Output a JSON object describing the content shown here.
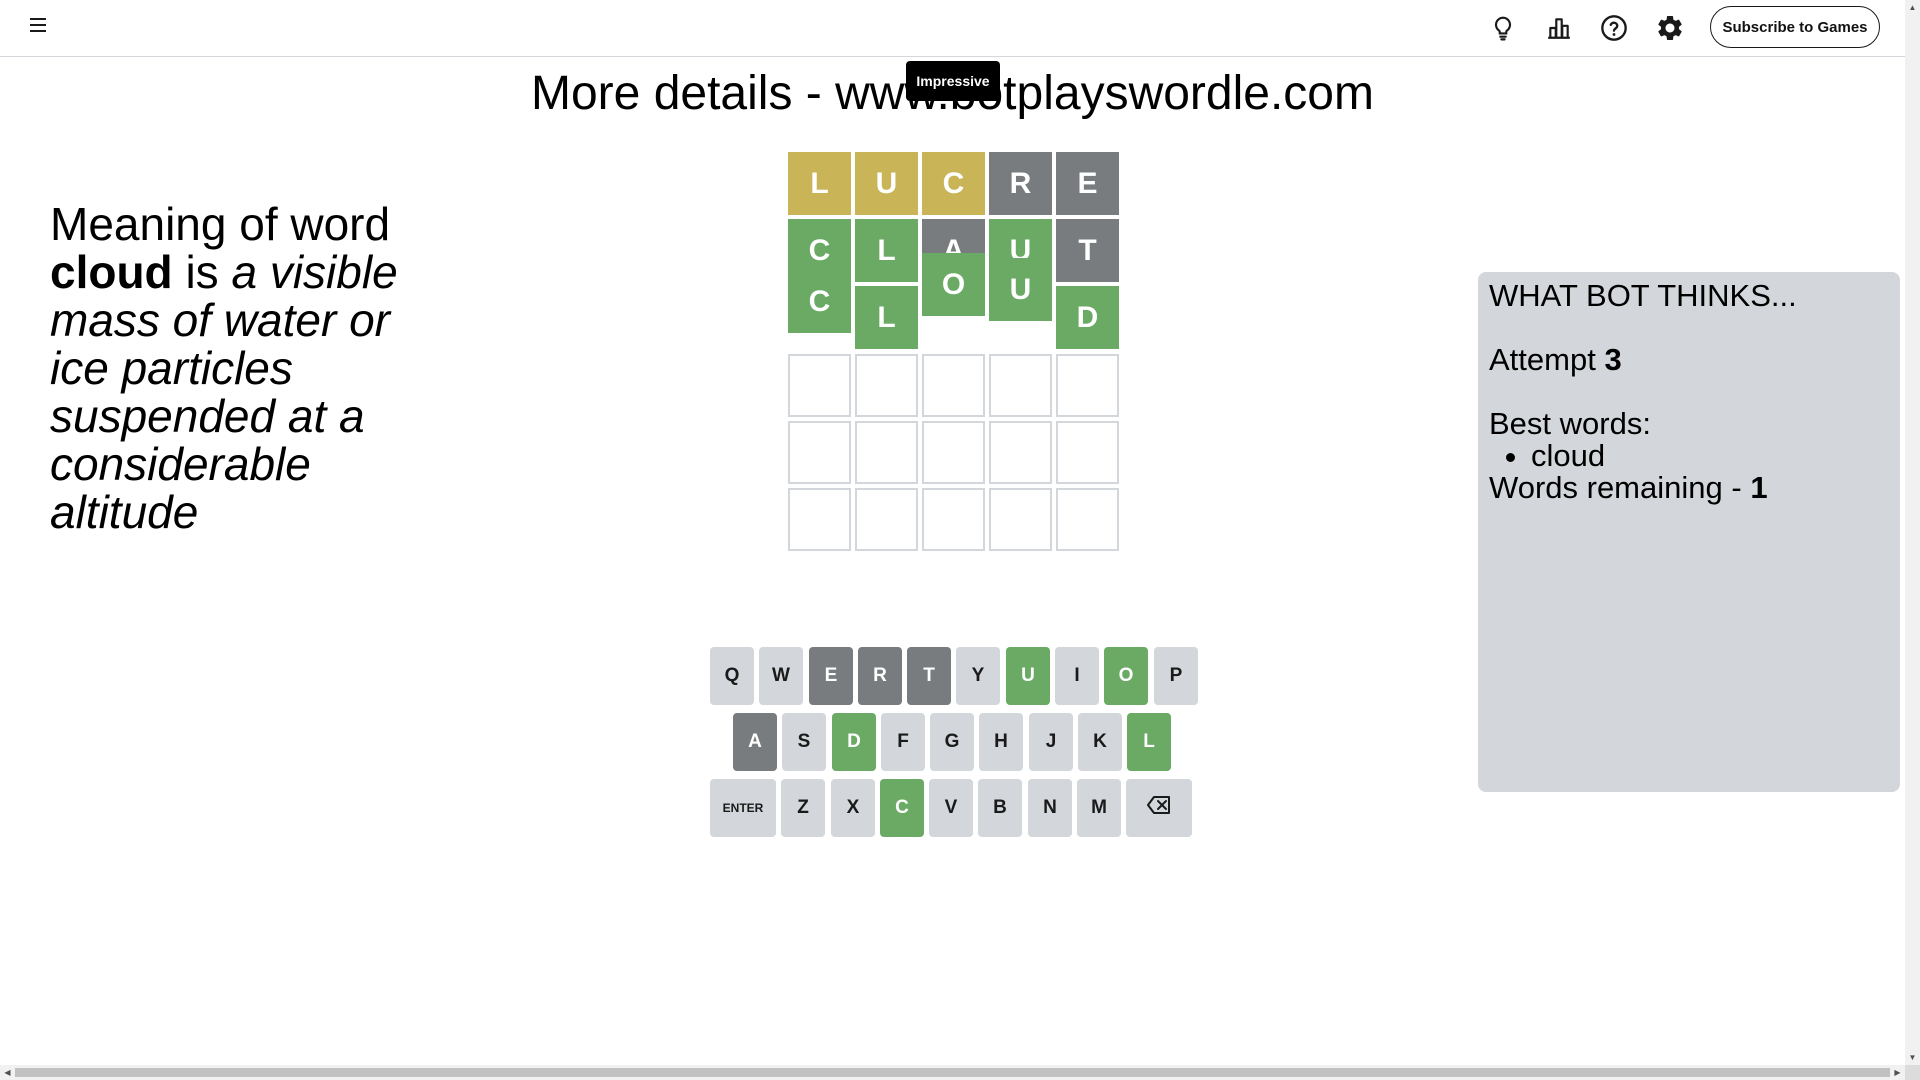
{
  "header": {
    "menu_icon": "hamburger-menu-icon",
    "icons": [
      "lightbulb-icon",
      "leaderboard-icon",
      "help-icon",
      "settings-icon"
    ],
    "subscribe_label": "Subscribe to Games"
  },
  "title": "More details - www.botplayswordle.com",
  "toast": "Impressive",
  "meaning": {
    "prefix": "Meaning of word",
    "word": "cloud",
    "connector": "is",
    "definition": "a visible mass of water or ice particles suspended at a considerable altitude"
  },
  "board": {
    "rows": [
      [
        {
          "letter": "L",
          "state": "present"
        },
        {
          "letter": "U",
          "state": "present"
        },
        {
          "letter": "C",
          "state": "present"
        },
        {
          "letter": "R",
          "state": "absent"
        },
        {
          "letter": "E",
          "state": "absent"
        }
      ],
      [
        {
          "letter": "C",
          "state": "correct"
        },
        {
          "letter": "L",
          "state": "correct"
        },
        {
          "letter": "A",
          "state": "absent"
        },
        {
          "letter": "U",
          "state": "correct"
        },
        {
          "letter": "T",
          "state": "absent"
        }
      ],
      [
        {
          "letter": "C",
          "state": "correct"
        },
        {
          "letter": "L",
          "state": "correct"
        },
        {
          "letter": "O",
          "state": "correct"
        },
        {
          "letter": "U",
          "state": "correct"
        },
        {
          "letter": "D",
          "state": "correct"
        }
      ],
      [
        {
          "letter": "",
          "state": "empty"
        },
        {
          "letter": "",
          "state": "empty"
        },
        {
          "letter": "",
          "state": "empty"
        },
        {
          "letter": "",
          "state": "empty"
        },
        {
          "letter": "",
          "state": "empty"
        }
      ],
      [
        {
          "letter": "",
          "state": "empty"
        },
        {
          "letter": "",
          "state": "empty"
        },
        {
          "letter": "",
          "state": "empty"
        },
        {
          "letter": "",
          "state": "empty"
        },
        {
          "letter": "",
          "state": "empty"
        }
      ],
      [
        {
          "letter": "",
          "state": "empty"
        },
        {
          "letter": "",
          "state": "empty"
        },
        {
          "letter": "",
          "state": "empty"
        },
        {
          "letter": "",
          "state": "empty"
        },
        {
          "letter": "",
          "state": "empty"
        }
      ]
    ]
  },
  "keyboard": {
    "rows": [
      [
        {
          "label": "Q",
          "state": "unused"
        },
        {
          "label": "W",
          "state": "unused"
        },
        {
          "label": "E",
          "state": "absent"
        },
        {
          "label": "R",
          "state": "absent"
        },
        {
          "label": "T",
          "state": "absent"
        },
        {
          "label": "Y",
          "state": "unused"
        },
        {
          "label": "U",
          "state": "correct"
        },
        {
          "label": "I",
          "state": "unused"
        },
        {
          "label": "O",
          "state": "correct"
        },
        {
          "label": "P",
          "state": "unused"
        }
      ],
      [
        {
          "label": "A",
          "state": "absent"
        },
        {
          "label": "S",
          "state": "unused"
        },
        {
          "label": "D",
          "state": "correct"
        },
        {
          "label": "F",
          "state": "unused"
        },
        {
          "label": "G",
          "state": "unused"
        },
        {
          "label": "H",
          "state": "unused"
        },
        {
          "label": "J",
          "state": "unused"
        },
        {
          "label": "K",
          "state": "unused"
        },
        {
          "label": "L",
          "state": "correct"
        }
      ],
      [
        {
          "label": "ENTER",
          "state": "unused",
          "special": "enter"
        },
        {
          "label": "Z",
          "state": "unused"
        },
        {
          "label": "X",
          "state": "unused"
        },
        {
          "label": "C",
          "state": "correct"
        },
        {
          "label": "V",
          "state": "unused"
        },
        {
          "label": "B",
          "state": "unused"
        },
        {
          "label": "N",
          "state": "unused"
        },
        {
          "label": "M",
          "state": "unused"
        },
        {
          "label": "",
          "state": "unused",
          "special": "backspace",
          "icon": "backspace-icon"
        }
      ]
    ]
  },
  "bot_panel": {
    "heading": "WHAT BOT THINKS...",
    "attempt_label": "Attempt",
    "attempt_value": "3",
    "best_words_label": "Best words:",
    "best_words": [
      "cloud"
    ],
    "remaining_label": "Words remaining -",
    "remaining_value": "1"
  },
  "colors": {
    "correct": "#6aaa64",
    "present": "#c9b458",
    "absent": "#787c7e",
    "key_default": "#d3d6da",
    "panel_bg": "#d3d6da"
  }
}
